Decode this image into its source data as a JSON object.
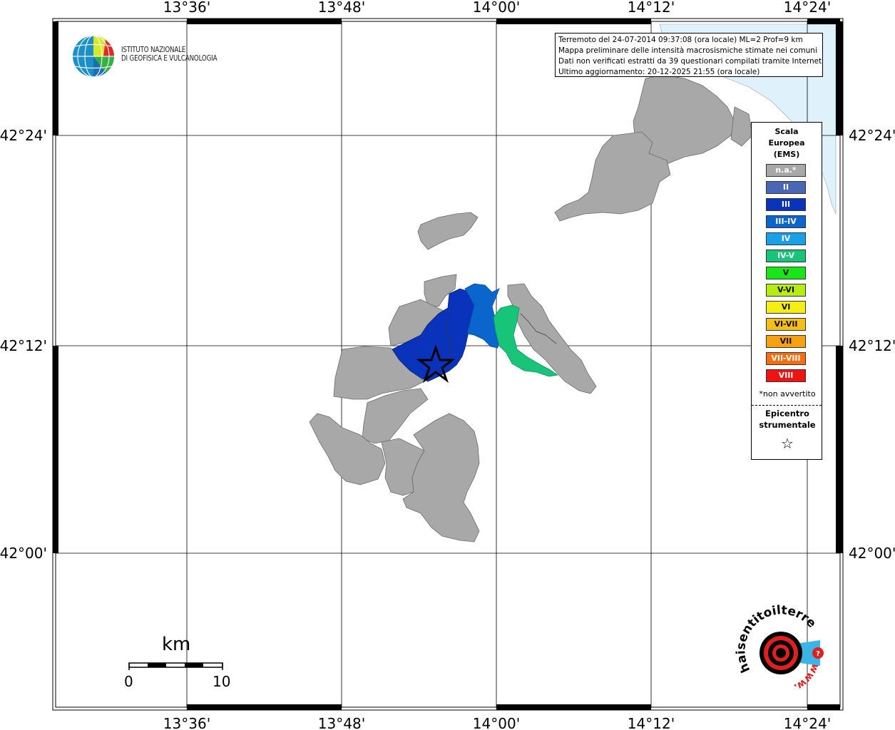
{
  "map": {
    "top_ticks": [
      "13°36'",
      "13°48'",
      "14°00'",
      "14°12'",
      "14°24'"
    ],
    "bottom_ticks": [
      "13°36'",
      "13°48'",
      "14°00'",
      "14°12'",
      "14°24'"
    ],
    "left_ticks": [
      "42°24'",
      "42°12'",
      "42°00'"
    ],
    "right_ticks": [
      "42°24'",
      "42°12'",
      "42°00'"
    ],
    "sea_color": "#dff1fb",
    "land_color": "#a8a8a8"
  },
  "logo": {
    "line1": "ISTITUTO NAZIONALE",
    "line2": "DI GEOFISICA E VULCANOLOGIA"
  },
  "info": {
    "line1": "Terremoto del 24-07-2014 09:37:08 (ora locale) ML=2 Prof=9 km",
    "line2": "Mappa preliminare delle intensità macrosismiche stimate nei comuni",
    "line3": "Dati non verificati estratti da 39 questionari compilati tramite Internet.",
    "line4": "Ultimo aggiornamento: 20-12-2025 21:55 (ora locale)"
  },
  "legend": {
    "title1": "Scala",
    "title2": "Europea",
    "title3": "(EMS)",
    "items": [
      {
        "label": "n.a.*",
        "color": "#a8a8a8"
      },
      {
        "label": "II",
        "color": "#4a66b6"
      },
      {
        "label": "III",
        "color": "#0a33bb"
      },
      {
        "label": "III-IV",
        "color": "#0a66cc"
      },
      {
        "label": "IV",
        "color": "#1aa0e6"
      },
      {
        "label": "IV-V",
        "color": "#18c47a"
      },
      {
        "label": "V",
        "color": "#19e619"
      },
      {
        "label": "V-VI",
        "color": "#b6ec12"
      },
      {
        "label": "VI",
        "color": "#f4ee12"
      },
      {
        "label": "VI-VII",
        "color": "#f4be16"
      },
      {
        "label": "VII",
        "color": "#f6a210"
      },
      {
        "label": "VII-VIII",
        "color": "#f66e10"
      },
      {
        "label": "VIII",
        "color": "#f21212"
      }
    ],
    "note": "*non avvertito",
    "epicenter1": "Epicentro",
    "epicenter2": "strumentale",
    "epicenter_icon": "star-outline-icon"
  },
  "scale_bar": {
    "unit": "km",
    "start": "0",
    "end": "10"
  },
  "haisentito": {
    "text": "haisentitoilterremoto.it",
    "www": "www."
  }
}
